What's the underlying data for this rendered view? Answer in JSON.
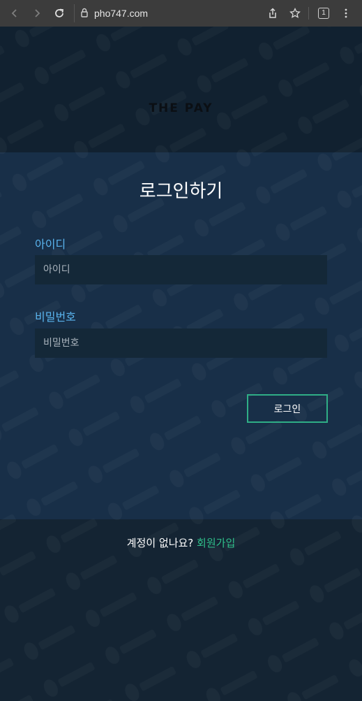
{
  "browser": {
    "url": "pho747.com",
    "tab_count": "1"
  },
  "logo_text": "THE PAY",
  "title": "로그인하기",
  "fields": {
    "id_label": "아이디",
    "id_placeholder": "아이디",
    "password_label": "비밀번호",
    "password_placeholder": "비밀번호"
  },
  "login_button": "로그인",
  "signup": {
    "prompt": "계정이 없나요? ",
    "link": "회원가입"
  },
  "colors": {
    "background": "#142433",
    "card": "#18304a",
    "label_blue": "#5ab4ee",
    "accent_green": "#2fae86"
  },
  "icons": [
    "back-icon",
    "forward-icon",
    "reload-icon",
    "site-info-icon",
    "share-icon",
    "bookmark-star-icon",
    "tab-count-icon",
    "menu-icon"
  ]
}
